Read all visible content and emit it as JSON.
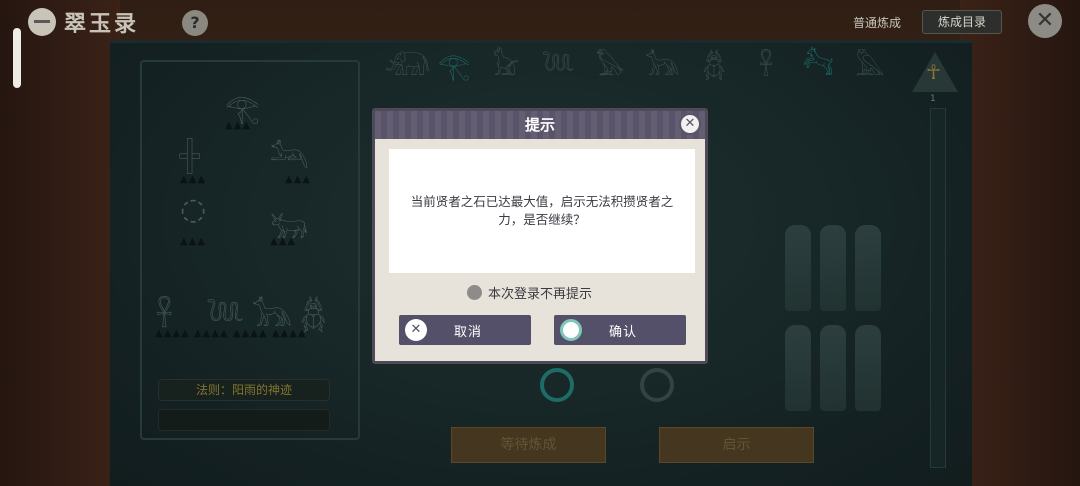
{
  "header": {
    "app_title": "翠玉录",
    "help_icon": "question-mark-icon",
    "mode_label": "普通炼成",
    "catalog_button": "炼成目录",
    "close_icon": "close-x-icon"
  },
  "board": {
    "glyphs": [
      "𓃰",
      "𓂀",
      "𓃠",
      "𓆙",
      "𓅃",
      "𓃥",
      "𓆣",
      "𓋹",
      "𓃚",
      "𓅓"
    ],
    "ankh_count": "1",
    "rule_label": "法则：阳雨的神迹",
    "wait_button": "等待炼成",
    "reveal_button": "启示"
  },
  "dialog": {
    "title": "提示",
    "message": "当前贤者之石已达最大值，启示无法积攒贤者之力，是否继续？",
    "dont_remind_label": "本次登录不再提示",
    "cancel_label": "取消",
    "confirm_label": "确认"
  }
}
